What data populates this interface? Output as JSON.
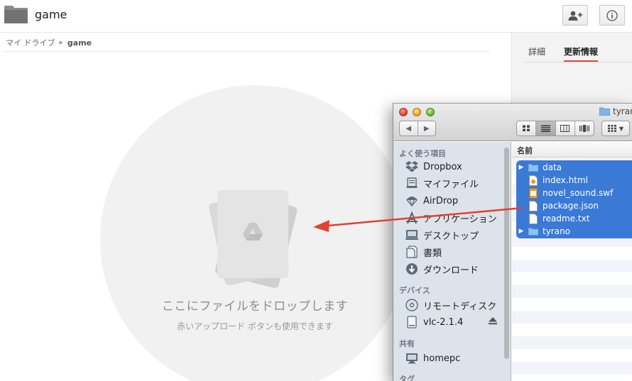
{
  "drive": {
    "folder_title": "game",
    "breadcrumb": {
      "root": "マイ ドライブ",
      "current": "game"
    },
    "drop_title": "ここにファイルをドロップします",
    "drop_subtitle": "赤いアップロード ボタンも使用できます",
    "details_tabs": [
      "詳細",
      "更新情報"
    ],
    "active_tab": "更新情報",
    "icons": {
      "share": "add-person-icon",
      "info": "info-icon"
    }
  },
  "finder": {
    "window_title": "tyrano",
    "sidebar": {
      "sections": [
        {
          "title": "よく使う項目",
          "items": [
            {
              "label": "Dropbox",
              "icon": "dropbox-icon"
            },
            {
              "label": "マイファイル",
              "icon": "all-files-icon"
            },
            {
              "label": "AirDrop",
              "icon": "airdrop-icon"
            },
            {
              "label": "アプリケーション",
              "icon": "applications-icon"
            },
            {
              "label": "デスクトップ",
              "icon": "desktop-icon"
            },
            {
              "label": "書類",
              "icon": "documents-icon"
            },
            {
              "label": "ダウンロード",
              "icon": "downloads-icon"
            }
          ]
        },
        {
          "title": "デバイス",
          "items": [
            {
              "label": "リモートディスク",
              "icon": "remote-disc-icon"
            },
            {
              "label": "vlc-2.1.4",
              "icon": "disk-image-icon",
              "ejectable": true
            }
          ]
        },
        {
          "title": "共有",
          "items": [
            {
              "label": "homepc",
              "icon": "computer-icon"
            }
          ]
        },
        {
          "title": "タグ",
          "items": []
        }
      ]
    },
    "list": {
      "column_header": "名前",
      "rows": [
        {
          "name": "data",
          "kind": "folder",
          "expandable": true
        },
        {
          "name": "index.html",
          "kind": "html",
          "expandable": false
        },
        {
          "name": "novel_sound.swf",
          "kind": "swf",
          "expandable": false
        },
        {
          "name": "package.json",
          "kind": "file",
          "expandable": false
        },
        {
          "name": "readme.txt",
          "kind": "file",
          "expandable": false
        },
        {
          "name": "tyrano",
          "kind": "folder",
          "expandable": true
        }
      ]
    }
  },
  "colors": {
    "selection": "#3b79d7",
    "arrow": "#e2412f",
    "details_accent": "#dd4b39",
    "finder_sidebar": "#dde3ea"
  }
}
